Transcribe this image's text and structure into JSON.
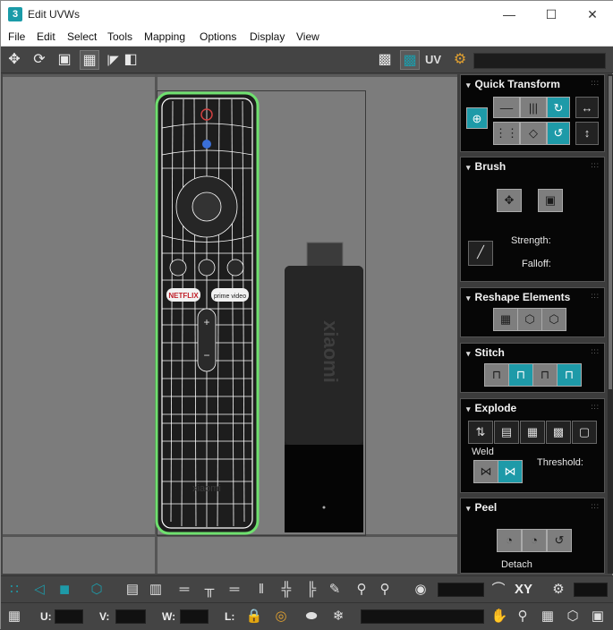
{
  "window": {
    "app_icon": "3",
    "title": "Edit UVWs",
    "minimize_icon": "minimize-icon",
    "maximize_icon": "maximize-icon",
    "close_icon": "close-icon"
  },
  "menu": [
    "File",
    "Edit",
    "Select",
    "Tools",
    "Mapping",
    "Options",
    "Display",
    "View"
  ],
  "toolbar": {
    "uv_label": "UV",
    "icons": [
      "move-icon",
      "rotate-icon",
      "scale-icon",
      "freeform-icon",
      "mirror-icon",
      "checker-icon",
      "show-map-icon",
      "map-settings-icon"
    ]
  },
  "viewport": {
    "remote_labels": {
      "netflix": "NETFLIX",
      "prime": "prime video",
      "plus": "+",
      "minus": "−",
      "brand": "xiaomi"
    },
    "stick_label": "xiaomi"
  },
  "rollouts": {
    "quick_transform": {
      "title": "Quick Transform"
    },
    "brush": {
      "title": "Brush",
      "strength_label": "Strength:",
      "falloff_label": "Falloff:"
    },
    "reshape": {
      "title": "Reshape Elements"
    },
    "stitch": {
      "title": "Stitch"
    },
    "explode": {
      "title": "Explode",
      "weld_label": "Weld",
      "threshold_label": "Threshold:"
    },
    "peel": {
      "title": "Peel",
      "detach_label": "Detach"
    }
  },
  "bottom": {
    "u_label": "U:",
    "v_label": "V:",
    "w_label": "W:",
    "l_label": "L:",
    "xy_label": "XY"
  },
  "colors": {
    "accent": "#1e9aa8",
    "selection": "#5fe05f",
    "panel_bg": "#060606",
    "viewport_bg": "#7c7c7c"
  }
}
